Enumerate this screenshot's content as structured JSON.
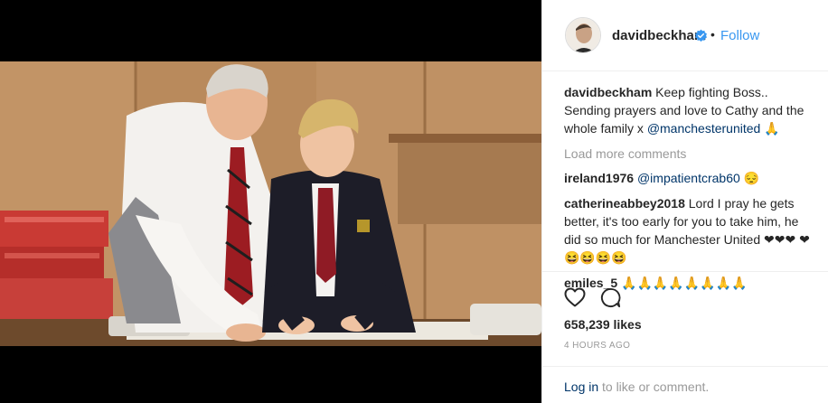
{
  "post": {
    "username": "davidbeckham",
    "dot": "•",
    "follow_label": "Follow",
    "caption": {
      "user": "davidbeckham",
      "text": "Keep fighting Boss.. Sending prayers and love to Cathy and the whole family x ",
      "mention": "@manchesterunited",
      "emoji": " 🙏"
    },
    "load_more": "Load more comments",
    "comments": [
      {
        "user": "ireland1976",
        "mention": "@impatientcrab60",
        "text": " 😔"
      },
      {
        "user": "catherineabbey2018",
        "text": "Lord I pray he gets better, it's too early for you to take him, he did so much for Manchester United ❤❤❤ ❤😆😆😆😆"
      },
      {
        "user": "emiles_5",
        "text": "🙏🙏🙏🙏🙏🙏🙏🙏"
      }
    ],
    "likes": "658,239 likes",
    "time_ago": "4 HOURS AGO",
    "login_link": "Log in",
    "login_rest": "to like or comment."
  },
  "icons": {
    "heart": "heart-outline-icon",
    "comment": "comment-bubble-icon",
    "verified": "verified-badge-icon"
  },
  "colors": {
    "link_blue": "#3897f0",
    "mention_navy": "#003569",
    "muted_gray": "#999999",
    "text": "#262626"
  }
}
